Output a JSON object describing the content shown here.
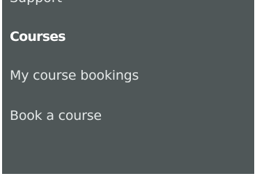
{
  "menu": {
    "clipped_item_label": "Support",
    "section_heading": "Courses",
    "items": [
      {
        "label": "My course bookings"
      },
      {
        "label": "Book a course"
      }
    ]
  },
  "colors": {
    "panel_background": "#4f5758",
    "heading_text": "#ffffff",
    "link_text": "#e4e8e8"
  }
}
